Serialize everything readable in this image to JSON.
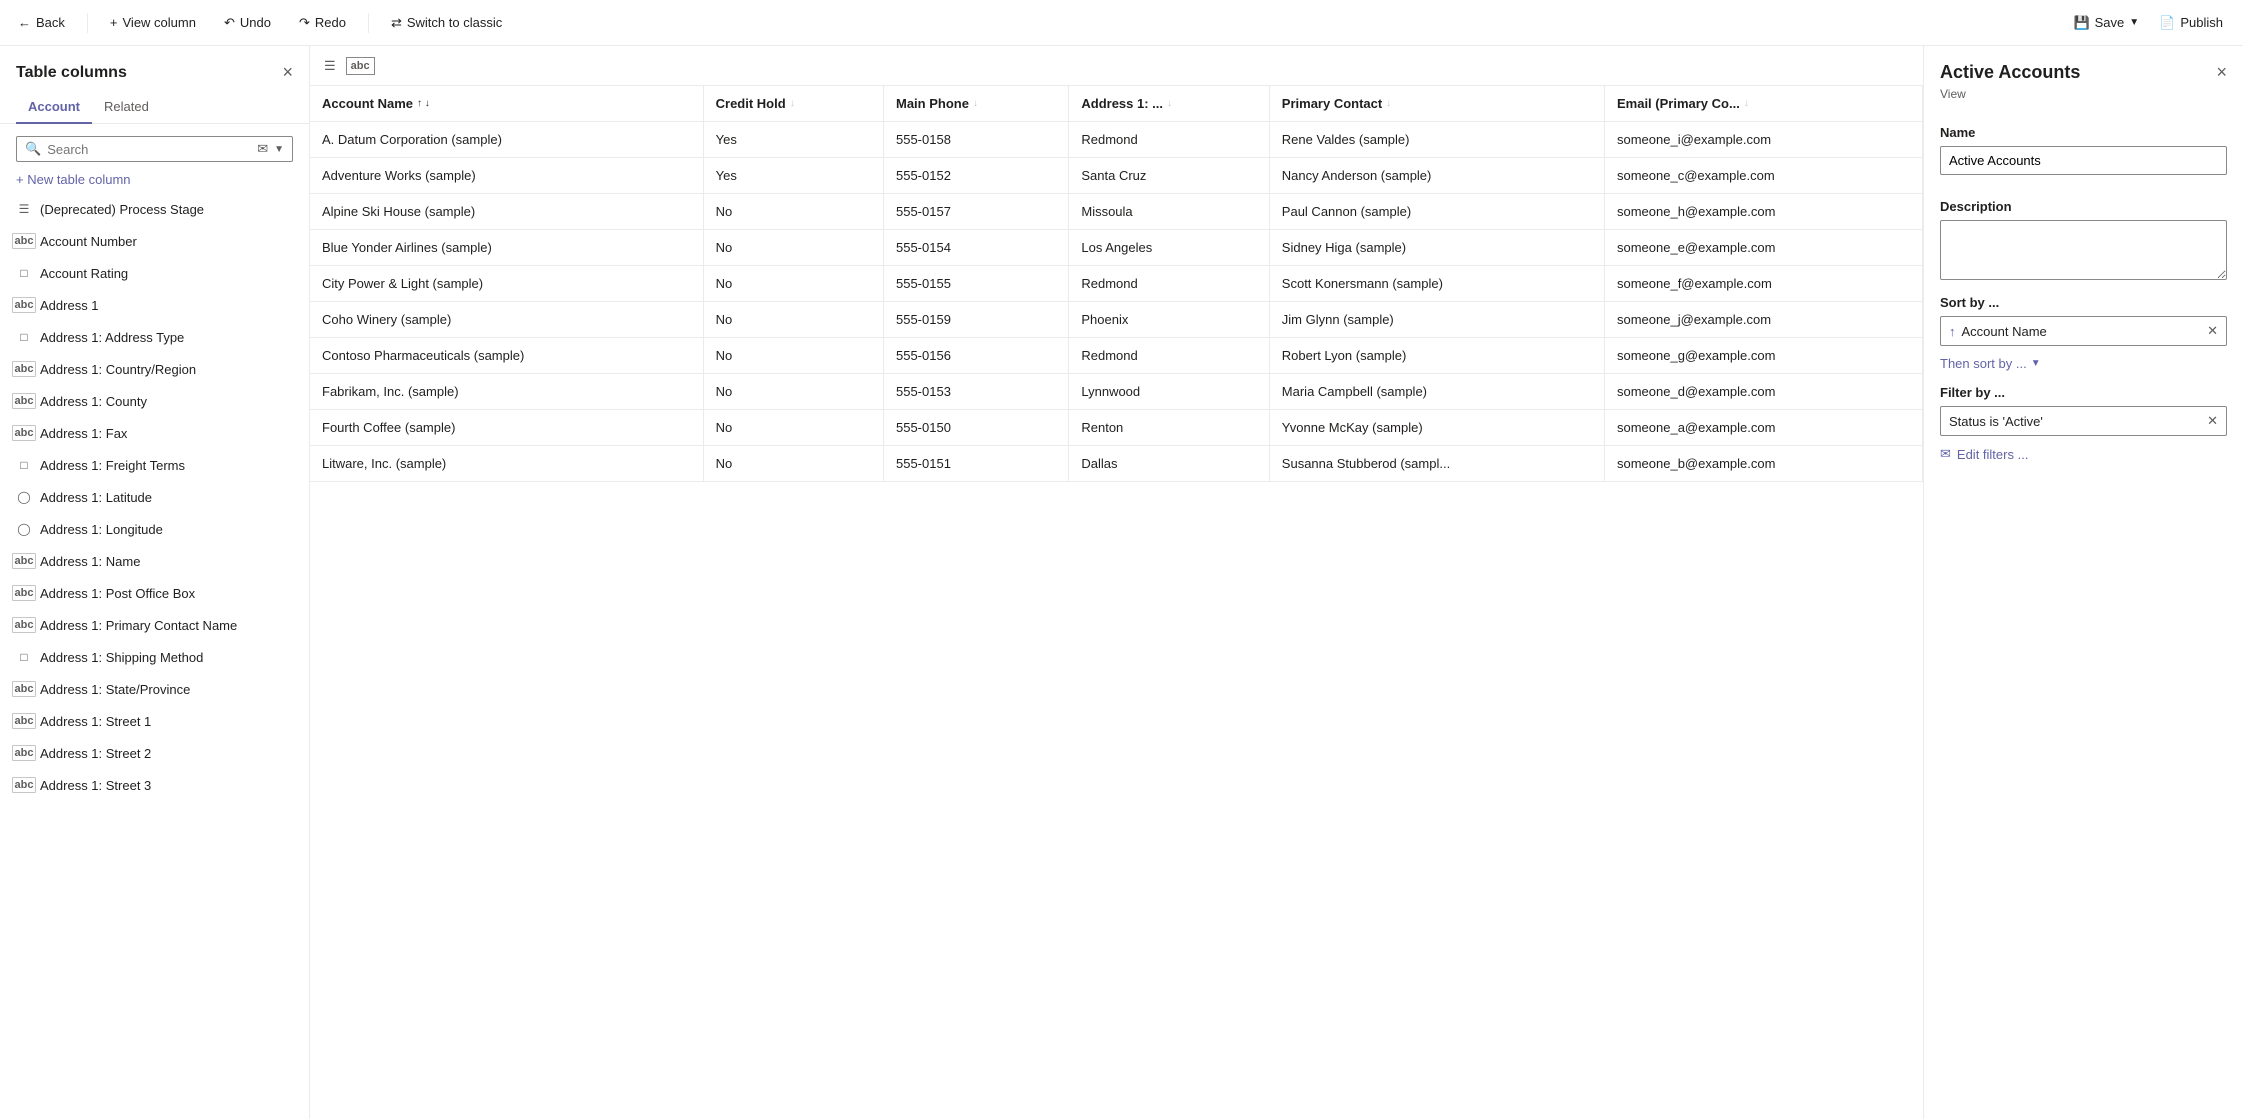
{
  "toolbar": {
    "back_label": "Back",
    "view_column_label": "View column",
    "undo_label": "Undo",
    "redo_label": "Redo",
    "switch_label": "Switch to classic",
    "save_label": "Save",
    "publish_label": "Publish"
  },
  "sidebar": {
    "title": "Table columns",
    "close_label": "×",
    "tabs": [
      {
        "id": "account",
        "label": "Account",
        "active": true
      },
      {
        "id": "related",
        "label": "Related",
        "active": false
      }
    ],
    "search_placeholder": "Search",
    "new_column_label": "+ New table column",
    "columns": [
      {
        "id": "deprecated-process-stage",
        "label": "(Deprecated) Process Stage",
        "icon": "list"
      },
      {
        "id": "account-number",
        "label": "Account Number",
        "icon": "abc"
      },
      {
        "id": "account-rating",
        "label": "Account Rating",
        "icon": "box"
      },
      {
        "id": "address-1",
        "label": "Address 1",
        "icon": "abc"
      },
      {
        "id": "address-1-address-type",
        "label": "Address 1: Address Type",
        "icon": "box"
      },
      {
        "id": "address-1-country-region",
        "label": "Address 1: Country/Region",
        "icon": "abc"
      },
      {
        "id": "address-1-county",
        "label": "Address 1: County",
        "icon": "abc"
      },
      {
        "id": "address-1-fax",
        "label": "Address 1: Fax",
        "icon": "abc"
      },
      {
        "id": "address-1-freight-terms",
        "label": "Address 1: Freight Terms",
        "icon": "box"
      },
      {
        "id": "address-1-latitude",
        "label": "Address 1: Latitude",
        "icon": "circle"
      },
      {
        "id": "address-1-longitude",
        "label": "Address 1: Longitude",
        "icon": "circle"
      },
      {
        "id": "address-1-name",
        "label": "Address 1: Name",
        "icon": "abc"
      },
      {
        "id": "address-1-post-office-box",
        "label": "Address 1: Post Office Box",
        "icon": "abc"
      },
      {
        "id": "address-1-primary-contact-name",
        "label": "Address 1: Primary Contact Name",
        "icon": "abc"
      },
      {
        "id": "address-1-shipping-method",
        "label": "Address 1: Shipping Method",
        "icon": "box"
      },
      {
        "id": "address-1-state-province",
        "label": "Address 1: State/Province",
        "icon": "abc"
      },
      {
        "id": "address-1-street-1",
        "label": "Address 1: Street 1",
        "icon": "abc"
      },
      {
        "id": "address-1-street-2",
        "label": "Address 1: Street 2",
        "icon": "abc"
      },
      {
        "id": "address-1-street-3",
        "label": "Address 1: Street 3",
        "icon": "abc"
      }
    ]
  },
  "table": {
    "columns": [
      {
        "id": "account-name",
        "label": "Account Name",
        "sort": "asc"
      },
      {
        "id": "credit-hold",
        "label": "Credit Hold"
      },
      {
        "id": "main-phone",
        "label": "Main Phone"
      },
      {
        "id": "address-1",
        "label": "Address 1: ..."
      },
      {
        "id": "primary-contact",
        "label": "Primary Contact"
      },
      {
        "id": "email-primary",
        "label": "Email (Primary Co..."
      }
    ],
    "rows": [
      {
        "account_name": "A. Datum Corporation (sample)",
        "credit_hold": "Yes",
        "main_phone": "555-0158",
        "address": "Redmond",
        "primary_contact": "Rene Valdes (sample)",
        "email": "someone_i@example.com"
      },
      {
        "account_name": "Adventure Works (sample)",
        "credit_hold": "Yes",
        "main_phone": "555-0152",
        "address": "Santa Cruz",
        "primary_contact": "Nancy Anderson (sample)",
        "email": "someone_c@example.com"
      },
      {
        "account_name": "Alpine Ski House (sample)",
        "credit_hold": "No",
        "main_phone": "555-0157",
        "address": "Missoula",
        "primary_contact": "Paul Cannon (sample)",
        "email": "someone_h@example.com"
      },
      {
        "account_name": "Blue Yonder Airlines (sample)",
        "credit_hold": "No",
        "main_phone": "555-0154",
        "address": "Los Angeles",
        "primary_contact": "Sidney Higa (sample)",
        "email": "someone_e@example.com"
      },
      {
        "account_name": "City Power & Light (sample)",
        "credit_hold": "No",
        "main_phone": "555-0155",
        "address": "Redmond",
        "primary_contact": "Scott Konersmann (sample)",
        "email": "someone_f@example.com"
      },
      {
        "account_name": "Coho Winery (sample)",
        "credit_hold": "No",
        "main_phone": "555-0159",
        "address": "Phoenix",
        "primary_contact": "Jim Glynn (sample)",
        "email": "someone_j@example.com"
      },
      {
        "account_name": "Contoso Pharmaceuticals (sample)",
        "credit_hold": "No",
        "main_phone": "555-0156",
        "address": "Redmond",
        "primary_contact": "Robert Lyon (sample)",
        "email": "someone_g@example.com"
      },
      {
        "account_name": "Fabrikam, Inc. (sample)",
        "credit_hold": "No",
        "main_phone": "555-0153",
        "address": "Lynnwood",
        "primary_contact": "Maria Campbell (sample)",
        "email": "someone_d@example.com"
      },
      {
        "account_name": "Fourth Coffee (sample)",
        "credit_hold": "No",
        "main_phone": "555-0150",
        "address": "Renton",
        "primary_contact": "Yvonne McKay (sample)",
        "email": "someone_a@example.com"
      },
      {
        "account_name": "Litware, Inc. (sample)",
        "credit_hold": "No",
        "main_phone": "555-0151",
        "address": "Dallas",
        "primary_contact": "Susanna Stubberod (sampl...",
        "email": "someone_b@example.com"
      }
    ]
  },
  "right_panel": {
    "title": "Active Accounts",
    "subtitle": "View",
    "close_label": "×",
    "name_label": "Name",
    "name_value": "Active Accounts",
    "description_label": "Description",
    "description_value": "",
    "sort_label": "Sort by ...",
    "sort_field": "Account Name",
    "then_sort_label": "Then sort by ...",
    "filter_label": "Filter by ...",
    "filter_value": "Status is 'Active'",
    "edit_filters_label": "Edit filters ..."
  }
}
